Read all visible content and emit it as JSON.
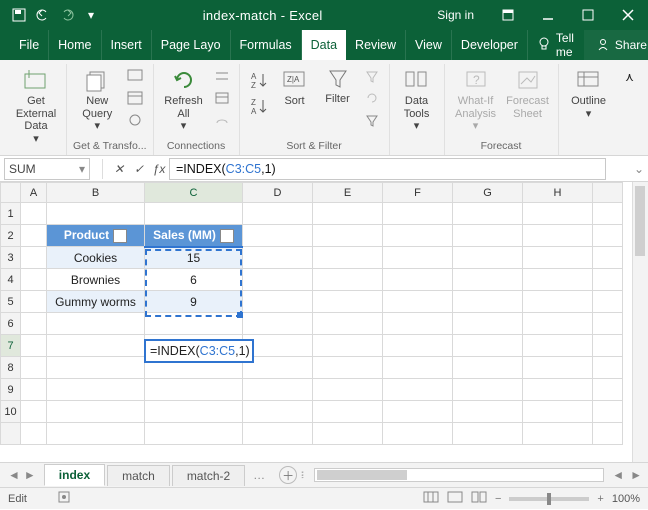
{
  "title": "index-match - Excel",
  "signin": "Sign in",
  "menus": [
    "File",
    "Home",
    "Insert",
    "Page Layo",
    "Formulas",
    "Data",
    "Review",
    "View",
    "Developer"
  ],
  "active_menu": "Data",
  "tellme": "Tell me",
  "share": "Share",
  "ribbon_groups": {
    "get_external": {
      "label": "",
      "btn": "Get External\nData"
    },
    "get_transform": {
      "label": "Get & Transfo...",
      "btn": "New\nQuery"
    },
    "connections": {
      "label": "Connections",
      "btn": "Refresh\nAll"
    },
    "sort_filter": {
      "label": "Sort & Filter",
      "sort": "Sort",
      "filter": "Filter"
    },
    "data_tools": {
      "label": "",
      "btn": "Data\nTools"
    },
    "forecast": {
      "label": "Forecast",
      "whatif": "What-If\nAnalysis",
      "forecast": "Forecast\nSheet"
    },
    "outline": {
      "label": "",
      "btn": "Outline"
    }
  },
  "namebox": "SUM",
  "formula_plain": "=INDEX(",
  "formula_ref": "C3:C5",
  "formula_tail": ",1)",
  "columns": [
    "A",
    "B",
    "C",
    "D",
    "E",
    "F",
    "G",
    "H"
  ],
  "rows": [
    "1",
    "2",
    "3",
    "4",
    "5",
    "6",
    "7",
    "8",
    "9",
    "10"
  ],
  "table": {
    "headers": {
      "product": "Product",
      "sales": "Sales (MM)"
    },
    "rows": [
      {
        "product": "Cookies",
        "sales": "15"
      },
      {
        "product": "Brownies",
        "sales": "6"
      },
      {
        "product": "Gummy worms",
        "sales": "9"
      }
    ]
  },
  "cell_formula": {
    "pre": "=INDEX(",
    "ref": "C3:C5",
    "post": ",1)"
  },
  "sheets": [
    "index",
    "match",
    "match-2"
  ],
  "active_sheet": "index",
  "status": "Edit",
  "zoom": "100%",
  "chart_data": {
    "type": "table",
    "title": "Sales (MM)",
    "categories": [
      "Cookies",
      "Brownies",
      "Gummy worms"
    ],
    "values": [
      15,
      6,
      9
    ]
  }
}
